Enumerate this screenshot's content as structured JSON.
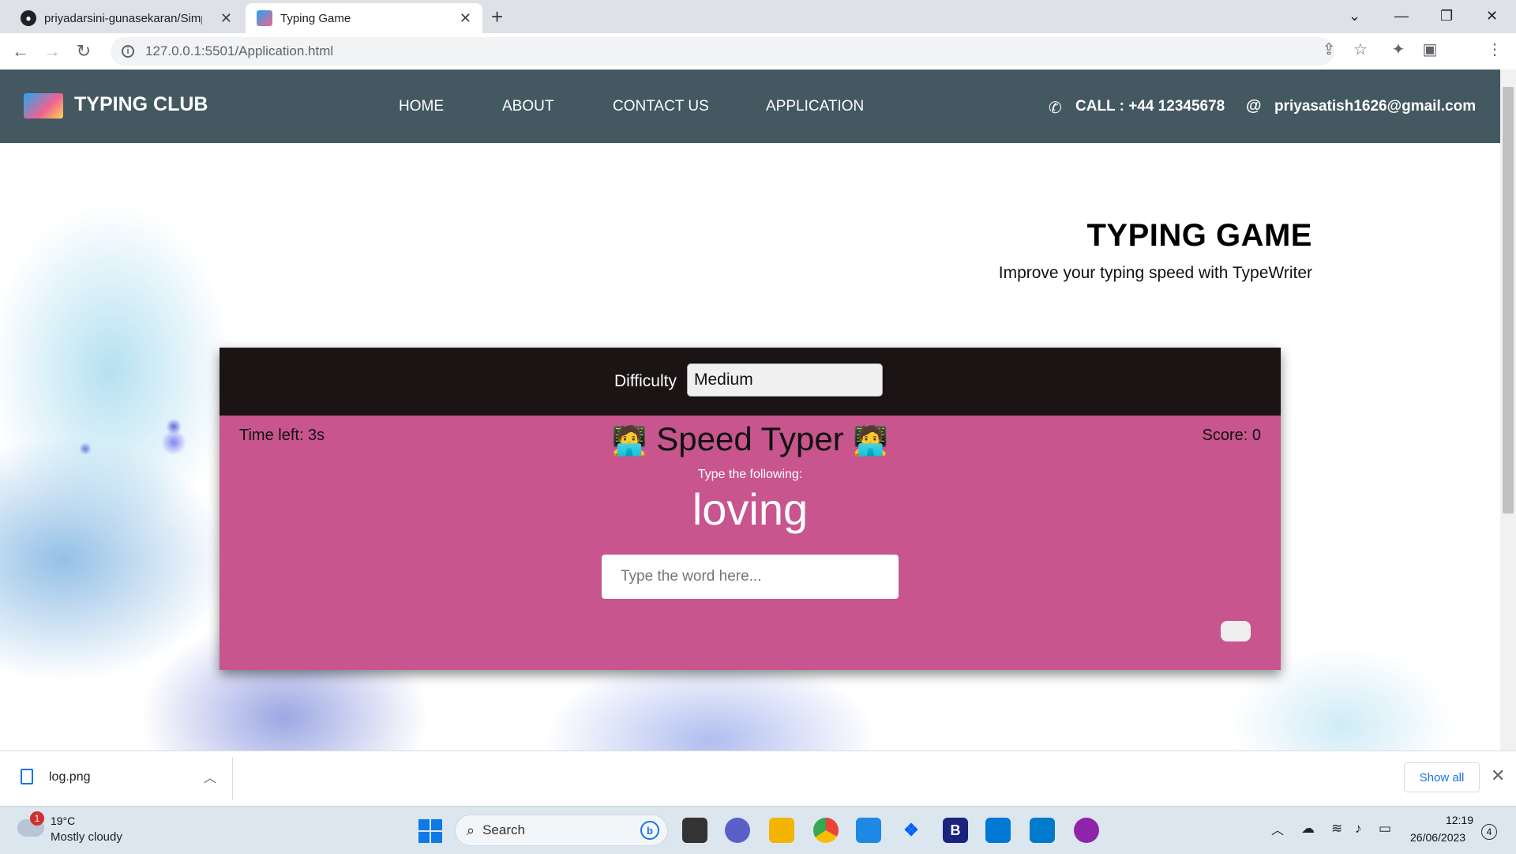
{
  "browser": {
    "tabs": [
      {
        "title": "priyadarsini-gunasekaran/Simple",
        "active": false
      },
      {
        "title": "Typing Game",
        "active": true
      }
    ],
    "url": "127.0.0.1:5501/Application.html"
  },
  "site": {
    "brand": "TYPING CLUB",
    "nav": [
      "HOME",
      "ABOUT",
      "CONTACT US",
      "APPLICATION"
    ],
    "call": "CALL : +44 12345678",
    "email": "priyasatish1626@gmail.com",
    "colors": {
      "navbar": "#435861",
      "game_header": "#1a1414",
      "game_body": "#c8558e"
    }
  },
  "hero": {
    "title": "TYPING GAME",
    "subtitle": "Improve your typing speed with TypeWriter"
  },
  "game": {
    "difficulty_label": "Difficulty",
    "difficulty_value": "Medium",
    "time_left": "Time left: 3s",
    "score": "Score: 0",
    "title": "Speed Typer",
    "title_emoji": "🧑‍💻",
    "prompt": "Type the following:",
    "word": "loving",
    "input_placeholder": "Type the word here..."
  },
  "downloads": {
    "file": "log.png",
    "show_all": "Show all"
  },
  "taskbar": {
    "weather_badge": "1",
    "temperature": "19°C",
    "weather": "Mostly cloudy",
    "search_label": "Search",
    "time": "12:19",
    "date": "26/06/2023",
    "notifications": "4"
  }
}
